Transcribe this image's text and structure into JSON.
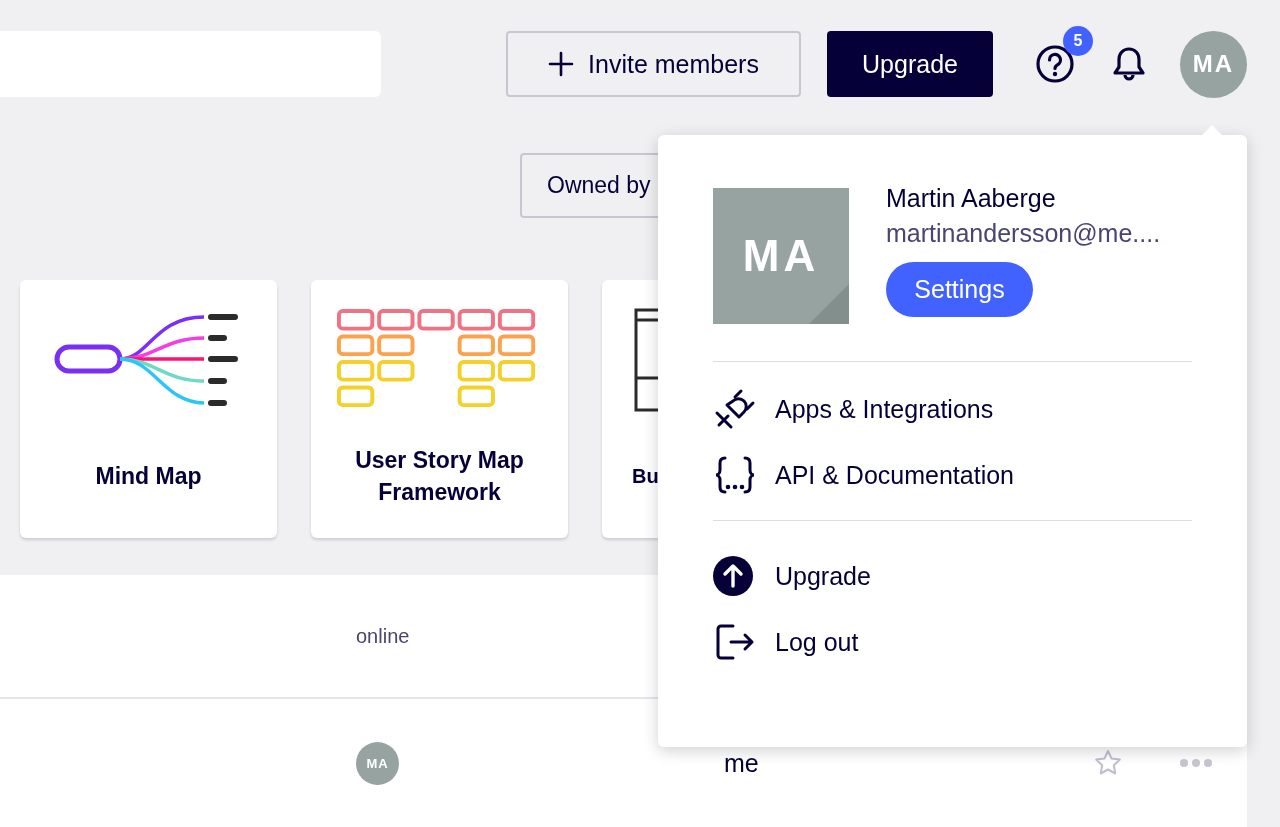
{
  "header": {
    "invite_button": "Invite members",
    "upgrade_button": "Upgrade",
    "help_badge": "5",
    "avatar_initials": "MA"
  },
  "filter": {
    "label": "Owned by"
  },
  "templates": [
    {
      "kind": "mind_map",
      "title": "Mind Map"
    },
    {
      "kind": "story_map",
      "title": "User Story Map Framework"
    },
    {
      "kind": "table",
      "title": "Bu"
    }
  ],
  "table": {
    "columns": [
      "online"
    ],
    "rows": [
      {
        "avatar": "MA",
        "owner": "me",
        "starred": false
      }
    ]
  },
  "account_menu": {
    "initials": "MA",
    "name": "Martin Aaberge",
    "email": "martinandersson@me....",
    "settings_button": "Settings",
    "sections": [
      [
        {
          "kind": "plug",
          "label": "Apps & Integrations"
        },
        {
          "kind": "braces",
          "label": "API & Documentation"
        }
      ],
      [
        {
          "kind": "upgrade",
          "label": "Upgrade"
        },
        {
          "kind": "logout",
          "label": "Log out"
        }
      ]
    ]
  }
}
